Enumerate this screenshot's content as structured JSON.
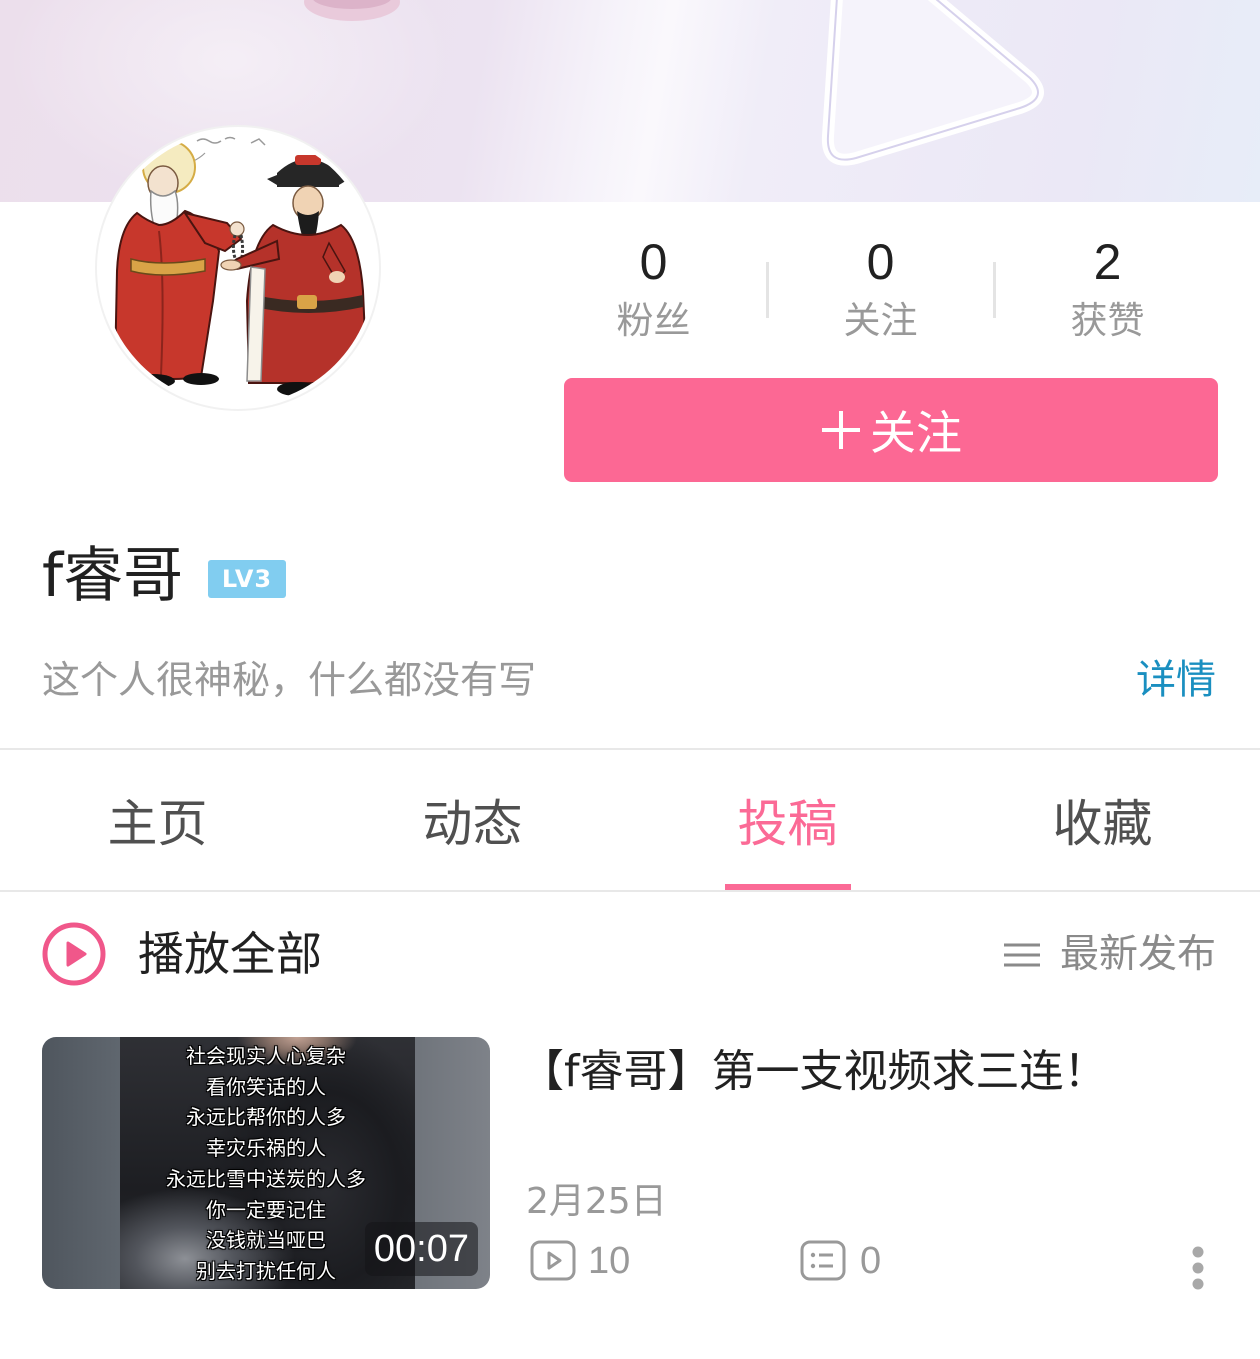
{
  "colors": {
    "accent": "#fc6894",
    "tab_active": "#fb6a96",
    "link": "#1a8fc0",
    "level_badge": "#81cdf0",
    "text_primary": "#212121",
    "text_secondary": "#999999"
  },
  "profile": {
    "stats": [
      {
        "value": "0",
        "label": "粉丝"
      },
      {
        "value": "0",
        "label": "关注"
      },
      {
        "value": "2",
        "label": "获赞"
      }
    ],
    "follow_button": {
      "icon": "plus-icon",
      "label": "关注"
    },
    "username": "f睿哥",
    "level_badge": "LV3",
    "bio": "这个人很神秘，什么都没有写",
    "details_link": "详情"
  },
  "tabs": [
    {
      "label": "主页",
      "active": false
    },
    {
      "label": "动态",
      "active": false
    },
    {
      "label": "投稿",
      "active": true
    },
    {
      "label": "收藏",
      "active": false
    }
  ],
  "list_header": {
    "play_all_icon": "play-circle-icon",
    "play_all_label": "播放全部",
    "sort_icon": "list-icon",
    "sort_label": "最新发布"
  },
  "videos": [
    {
      "title": "【f睿哥】第一支视频求三连！",
      "thumbnail_text": [
        "社会现实人心复杂",
        "看你笑话的人",
        "永远比帮你的人多",
        "幸灾乐祸的人",
        "永远比雪中送炭的人多",
        "你一定要记住",
        "没钱就当哑巴",
        "别去打扰任何人"
      ],
      "duration": "00:07",
      "date": "2月25日",
      "views_icon": "play-count-icon",
      "views": "10",
      "comments_icon": "comment-icon",
      "comments": "0",
      "menu_icon": "more-vertical-icon"
    }
  ]
}
